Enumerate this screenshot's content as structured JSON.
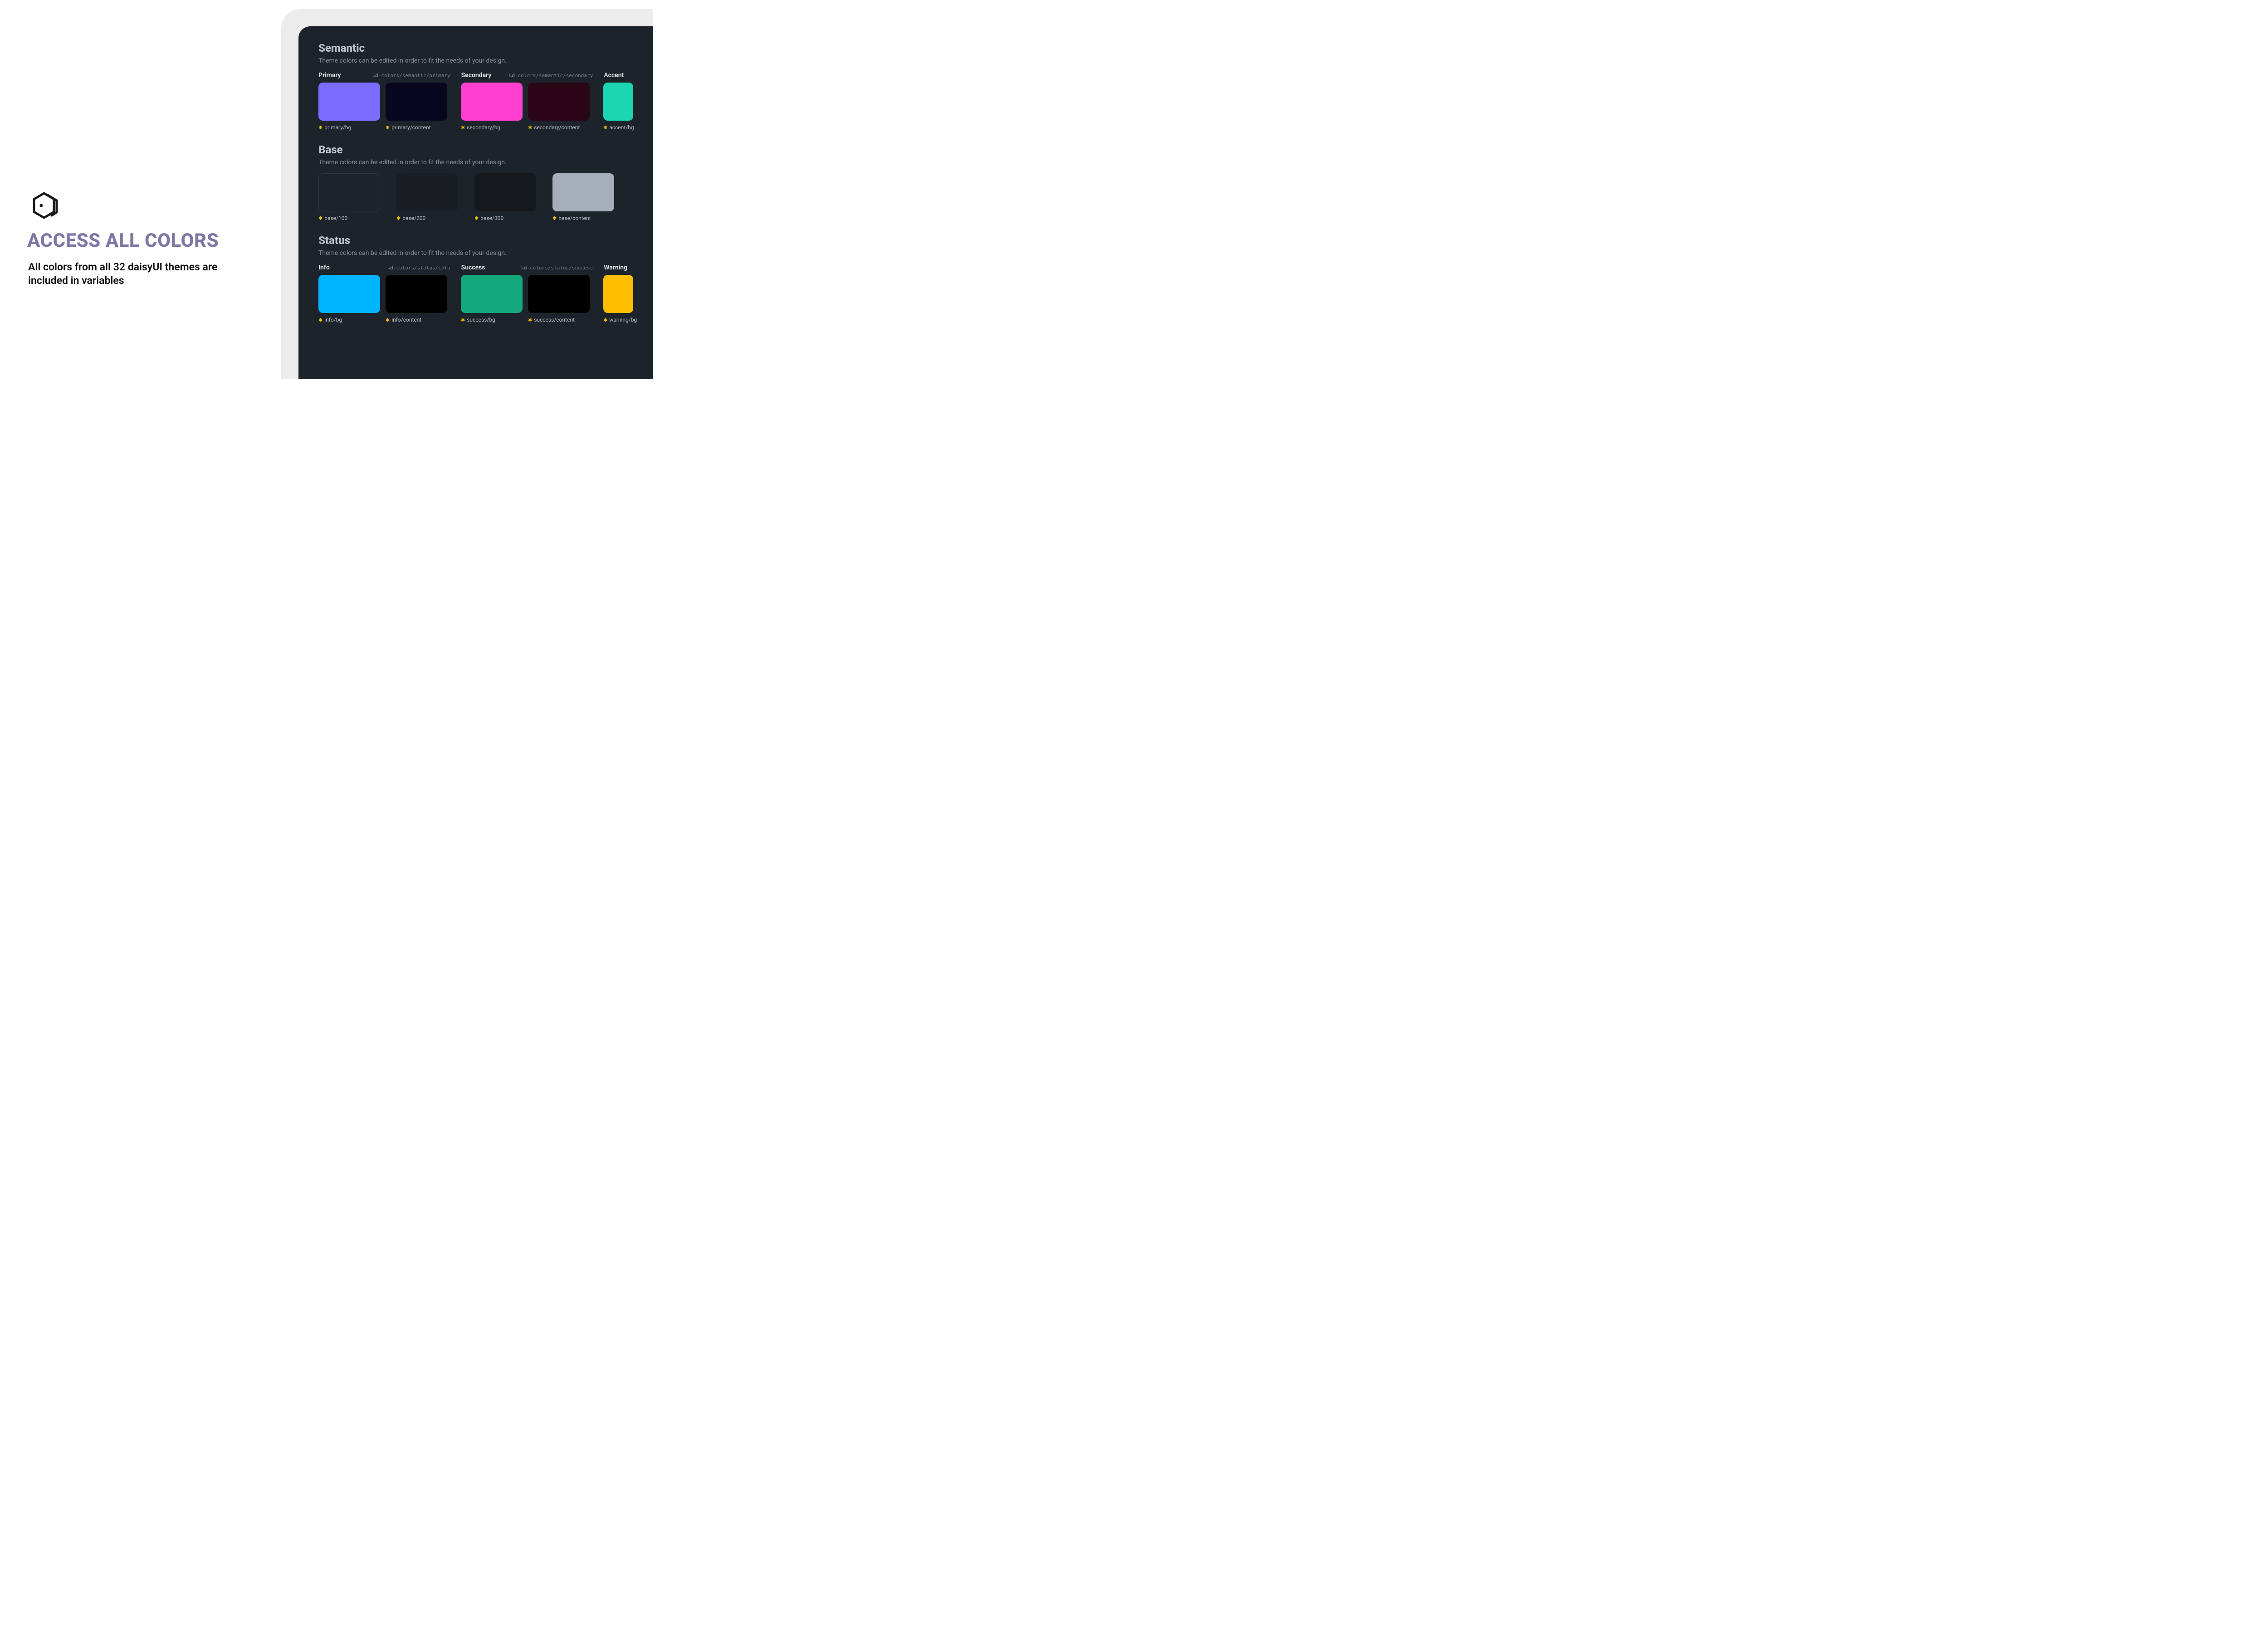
{
  "hero": {
    "headline": "ACCESS ALL COLORS",
    "subhead": "All colors from all 32 daisyUI themes are included in variables"
  },
  "sections": {
    "semantic": {
      "title": "Semantic",
      "sub": "Theme colors can be edited in order to fit the needs of your design.",
      "groups": {
        "primary": {
          "label": "Primary",
          "path_prefix": "↳",
          "path_bold": "d",
          "path_tail": "-colors/semantic/primary"
        },
        "secondary": {
          "label": "Secondary",
          "path_prefix": "↳",
          "path_bold": "d",
          "path_tail": "-colors/semantic/secondary"
        },
        "accent": {
          "label": "Accent"
        }
      },
      "tokens": {
        "primary_bg": "primary/bg",
        "primary_content": "primary/content",
        "secondary_bg": "secondary/bg",
        "secondary_content": "secondary/content",
        "accent_bg": "accent/bg"
      }
    },
    "base": {
      "title": "Base",
      "sub": "Theme colors can be edited in order to fit the needs of your design.",
      "tokens": {
        "b100": "base/100",
        "b200": "base/200",
        "b300": "base/300",
        "bcontent": "base/content"
      }
    },
    "status": {
      "title": "Status",
      "sub": "Theme colors can be edited in order to fit the needs of your design.",
      "groups": {
        "info": {
          "label": "Info",
          "path_prefix": "↳",
          "path_bold": "d",
          "path_tail": "-colors/status/info"
        },
        "success": {
          "label": "Success",
          "path_prefix": "↳",
          "path_bold": "d",
          "path_tail": "-colors/status/success"
        },
        "warning": {
          "label": "Warning"
        }
      },
      "tokens": {
        "info_bg": "info/bg",
        "info_content": "info/content",
        "success_bg": "success/bg",
        "success_content": "success/content",
        "warning_bg": "warning/bg"
      }
    }
  },
  "colors": {
    "primary_bg": "#7b6cff",
    "primary_content": "#070720",
    "secondary_bg": "#ff3fd1",
    "secondary_content": "#2a0516",
    "accent_bg": "#1bd6b0",
    "base_100": "#1d232a",
    "base_200": "#191e24",
    "base_300": "#15191e",
    "base_content": "#a6adbb",
    "info_bg": "#00b5ff",
    "info_content": "#000000",
    "success_bg": "#13a97a",
    "success_content": "#000000",
    "warning_bg": "#ffbe00"
  }
}
